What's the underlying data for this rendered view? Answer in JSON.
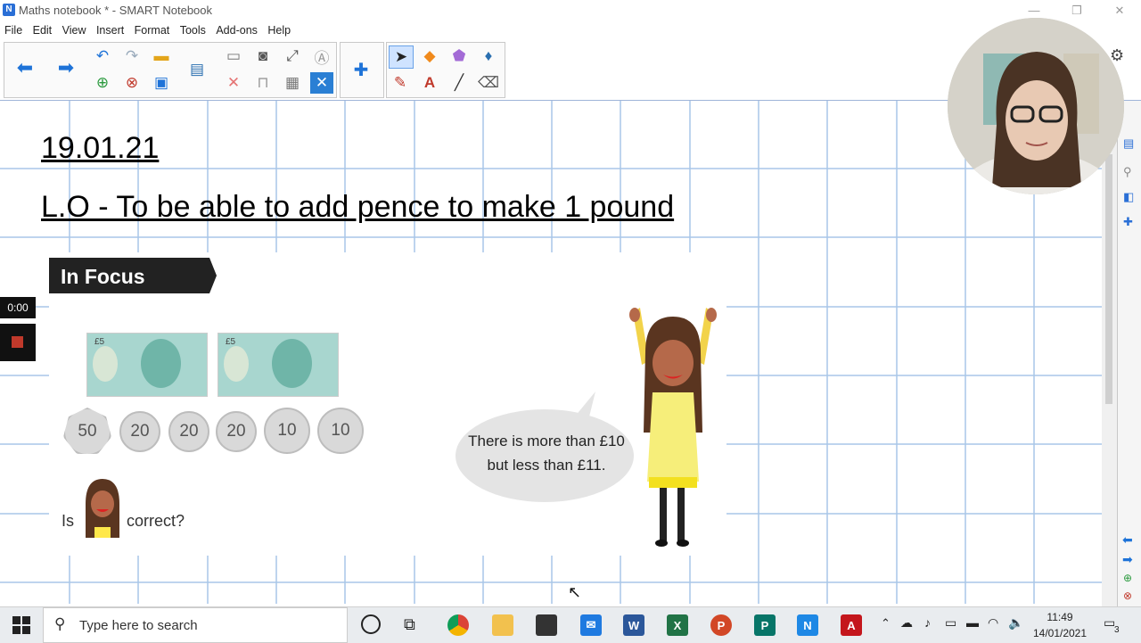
{
  "window": {
    "title": "Maths notebook * - SMART Notebook",
    "app_letter": "N"
  },
  "menu": [
    "File",
    "Edit",
    "View",
    "Insert",
    "Format",
    "Tools",
    "Add-ons",
    "Help"
  ],
  "slide": {
    "date": "19.01.21",
    "objective": "L.O - To be able to add pence to make 1 pound",
    "banner": "In Focus",
    "notes": [
      "£5",
      "£5"
    ],
    "coins": [
      "50",
      "20",
      "20",
      "20",
      "10",
      "10"
    ],
    "question_is": "Is",
    "question_correct": "correct?",
    "speech": "There is more than £10 but less than £11."
  },
  "recorder": {
    "time": "0:00"
  },
  "taskbar": {
    "search_placeholder": "Type here to search",
    "time": "11:49",
    "date": "14/01/2021",
    "notifications": "3"
  },
  "icons": [
    "back-arrow",
    "forward-arrow",
    "undo",
    "redo",
    "open-folder",
    "screen-shade",
    "save",
    "paste",
    "camera",
    "delete",
    "table",
    "select",
    "pen",
    "text",
    "line",
    "eraser",
    "shapes",
    "fill",
    "magic-pen"
  ],
  "colors": {
    "grid": "#a9c6e8",
    "accent": "#1e73d8",
    "banner": "#222222"
  }
}
